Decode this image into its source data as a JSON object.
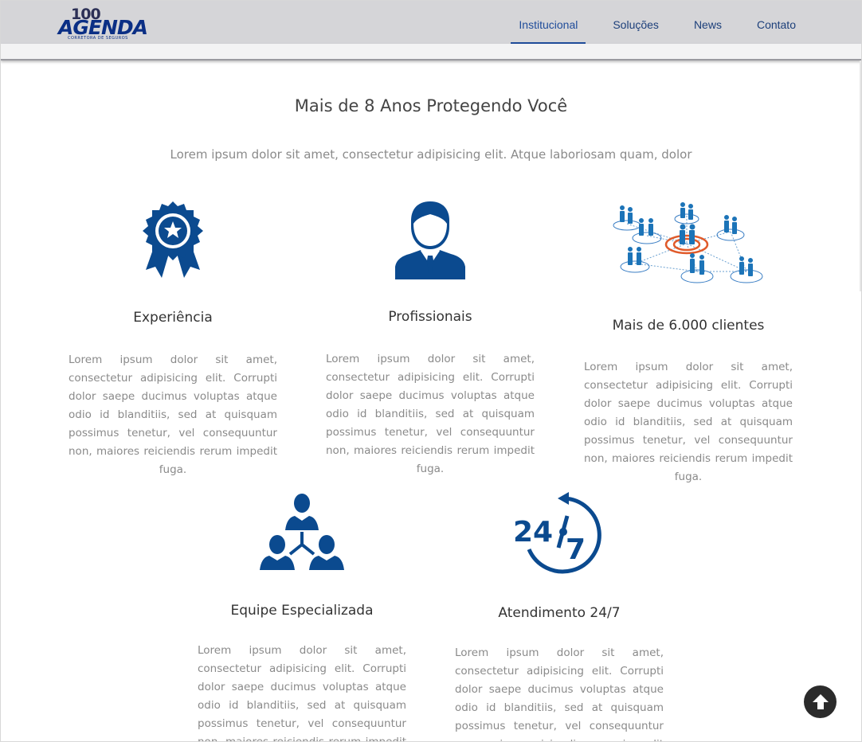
{
  "header": {
    "logo": {
      "number": "100",
      "word": "AGENDA",
      "tagline": "CORRETORA DE SEGUROS"
    },
    "nav": [
      {
        "label": "Institucional",
        "active": true
      },
      {
        "label": "Soluções",
        "active": false
      },
      {
        "label": "News",
        "active": false
      },
      {
        "label": "Contato",
        "active": false
      }
    ]
  },
  "section": {
    "title": "Mais de 8 Anos Protegendo Você",
    "subtitle": "Lorem ipsum dolor sit amet, consectetur adipisicing elit. Atque laboriosam quam, dolor"
  },
  "features": [
    {
      "icon": "award-ribbon-icon",
      "title": "Experiência",
      "text": "Lorem ipsum dolor sit amet, consectetur adipisicing elit. Corrupti dolor saepe ducimus voluptas atque odio id blanditiis, sed at quisquam possimus tenetur, vel consequuntur non, maiores reiciendis rerum impedit fuga."
    },
    {
      "icon": "businessman-icon",
      "title": "Profissionais",
      "text": "Lorem ipsum dolor sit amet, consectetur adipisicing elit. Corrupti dolor saepe ducimus voluptas atque odio id blanditiis, sed at quisquam possimus tenetur, vel consequuntur non, maiores reiciendis rerum impedit fuga."
    },
    {
      "icon": "client-network-icon",
      "title": "Mais de 6.000 clientes",
      "text": "Lorem ipsum dolor sit amet, consectetur adipisicing elit. Corrupti dolor saepe ducimus voluptas atque odio id blanditiis, sed at quisquam possimus tenetur, vel consequuntur non, maiores reiciendis rerum impedit fuga."
    },
    {
      "icon": "team-hierarchy-icon",
      "title": "Equipe Especializada",
      "text": "Lorem ipsum dolor sit amet, consectetur adipisicing elit. Corrupti dolor saepe ducimus voluptas atque odio id blanditiis, sed at quisquam possimus tenetur, vel consequuntur non, maiores reiciendis rerum impedit fuga."
    },
    {
      "icon": "clock-24-7-icon",
      "title": "Atendimento 24/7",
      "text": "Lorem ipsum dolor sit amet, consectetur adipisicing elit. Corrupti dolor saepe ducimus voluptas atque odio id blanditiis, sed at quisquam possimus tenetur, vel consequuntur non, maiores reiciendis rerum impedit fuga."
    }
  ],
  "icon_24_7": {
    "hours": "24",
    "days": "7"
  },
  "colors": {
    "brand_blue": "#0b4a8f",
    "nav_text": "#1c3f7a",
    "header_bg": "#d5d5d8"
  },
  "scroll_top": {
    "icon": "arrow-up-icon"
  }
}
